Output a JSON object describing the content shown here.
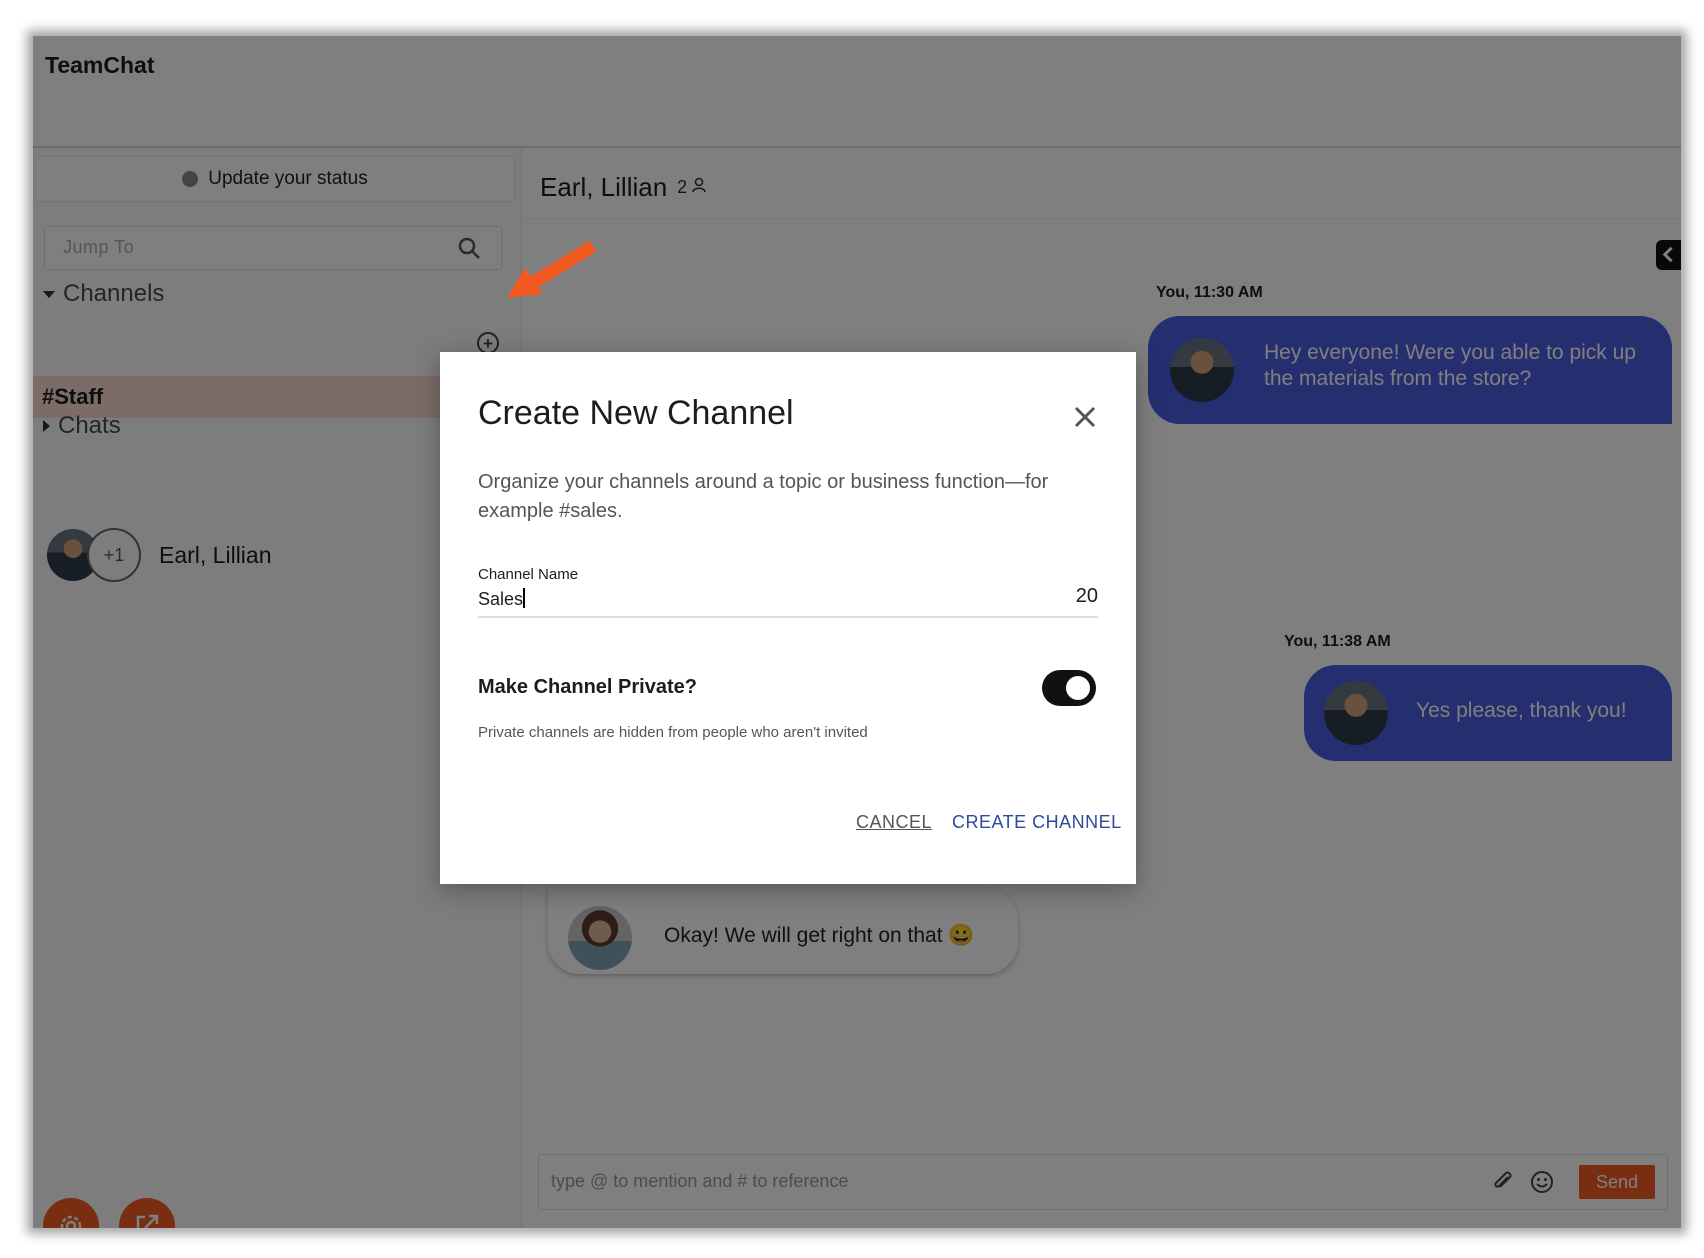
{
  "app": {
    "title": "TeamChat"
  },
  "sidebar": {
    "status_label": "Update your status",
    "jump_placeholder": "Jump To",
    "channels_heading": "Channels",
    "channels": [
      {
        "label": "#Staff"
      }
    ],
    "chats_heading": "Chats",
    "chats": [
      {
        "name": "Earl, Lillian",
        "extra_count": "+1"
      }
    ]
  },
  "conversation": {
    "title": "Earl, Lillian",
    "member_count": "2",
    "messages": [
      {
        "meta": "You, 11:30 AM",
        "text": "Hey everyone! Were you able to pick up the materials from the store?"
      },
      {
        "meta": "You, 11:38 AM",
        "text": "Yes please, thank you!"
      },
      {
        "meta": "",
        "text": "Okay! We will get right on that 😀"
      }
    ],
    "composer_placeholder": "type @ to mention and # to reference",
    "send_label": "Send"
  },
  "modal": {
    "title": "Create New Channel",
    "description": "Organize your channels around a topic or business function—for example #sales.",
    "field_label": "Channel Name",
    "field_value": "Sales",
    "char_count": "20",
    "private_label": "Make Channel Private?",
    "private_enabled": true,
    "private_help": "Private channels are hidden from people who aren't invited",
    "cancel_label": "CANCEL",
    "create_label": "CREATE CHANNEL"
  },
  "colors": {
    "accent": "#f35a22",
    "bubble": "#4a5ee0",
    "staff_highlight": "#f6d9d0",
    "primary_link": "#2f4a9c"
  }
}
